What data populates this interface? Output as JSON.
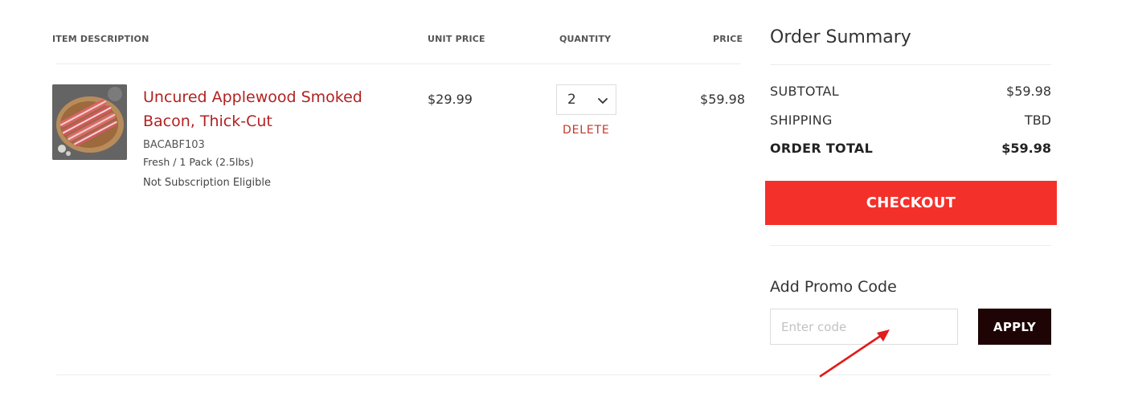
{
  "table": {
    "headers": {
      "description": "ITEM DESCRIPTION",
      "unit_price": "UNIT PRICE",
      "quantity": "QUANTITY",
      "price": "PRICE"
    }
  },
  "cart": {
    "items": [
      {
        "name": "Uncured Applewood Smoked Bacon, Thick-Cut",
        "sku": "BACABF103",
        "variant": "Fresh / 1 Pack (2.5lbs)",
        "subscription": "Not Subscription Eligible",
        "unit_price": "$29.99",
        "quantity": "2",
        "delete_label": "DELETE",
        "price": "$59.98"
      }
    ]
  },
  "summary": {
    "title": "Order Summary",
    "subtotal_label": "SUBTOTAL",
    "subtotal_value": "$59.98",
    "shipping_label": "SHIPPING",
    "shipping_value": "TBD",
    "total_label": "ORDER TOTAL",
    "total_value": "$59.98",
    "checkout_label": "CHECKOUT"
  },
  "promo": {
    "title": "Add Promo Code",
    "placeholder": "Enter code",
    "value": "",
    "apply_label": "APPLY"
  },
  "colors": {
    "accent_red": "#f4302b",
    "product_link": "#b22222",
    "apply_bg": "#1e0404",
    "annotation_arrow": "#e21b1b"
  },
  "icons": {
    "quantity_dropdown": "chevron-down-icon",
    "annotation": "arrow-annotation-icon"
  }
}
